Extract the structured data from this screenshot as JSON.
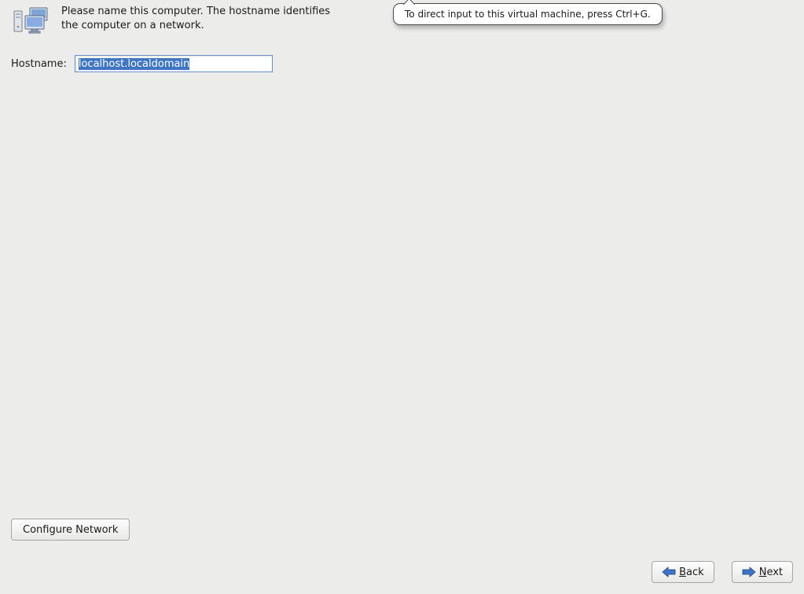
{
  "header": {
    "description": "Please name this computer.  The hostname identifies the computer on a network."
  },
  "hostname": {
    "label": "Hostname:",
    "value": "localhost.localdomain"
  },
  "vm_tip": "To direct input to this virtual machine, press Ctrl+G.",
  "buttons": {
    "configure_network": "Configure Network",
    "back_prefix": "B",
    "back_rest": "ack",
    "next_prefix": "N",
    "next_rest": "ext"
  }
}
